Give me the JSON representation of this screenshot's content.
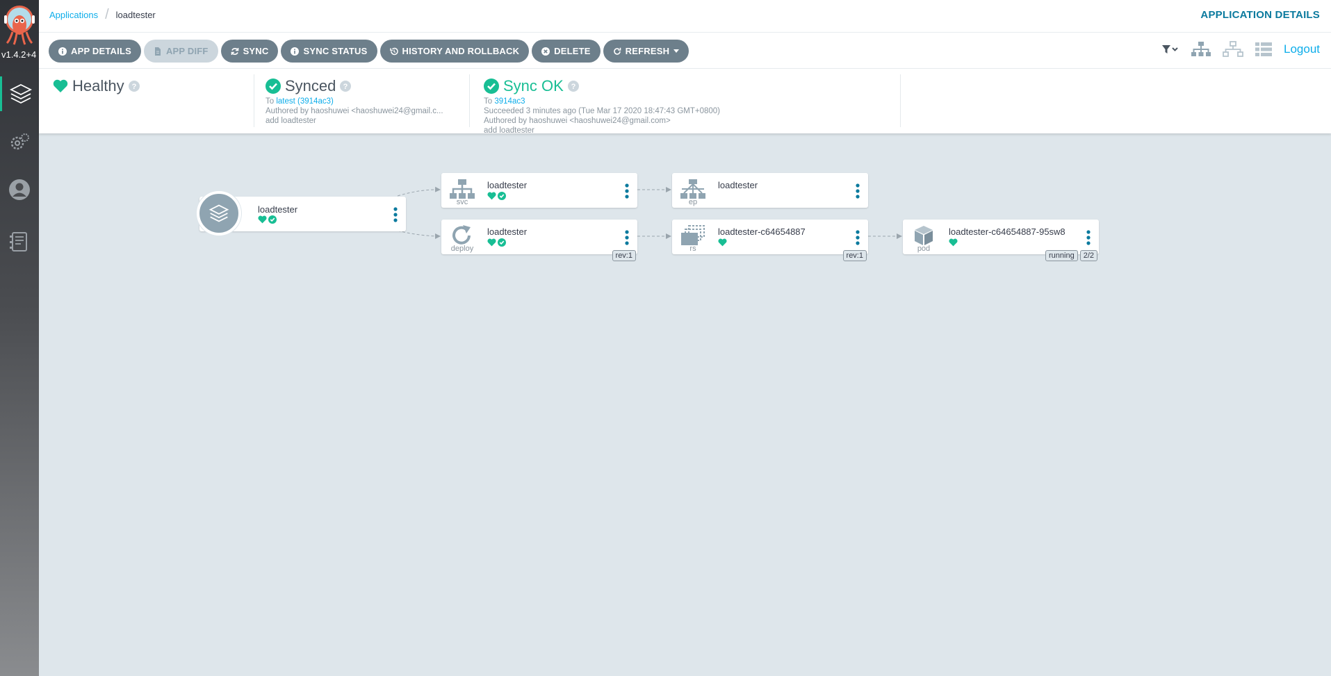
{
  "sidebar": {
    "version": "v1.4.2+4",
    "items": [
      {
        "name": "applications",
        "icon": "layers-icon"
      },
      {
        "name": "settings",
        "icon": "gear-icon"
      },
      {
        "name": "user-info",
        "icon": "user-icon"
      },
      {
        "name": "docs",
        "icon": "docs-icon"
      }
    ]
  },
  "header": {
    "breadcrumb": {
      "root": "Applications",
      "current": "loadtester"
    },
    "title": "APPLICATION DETAILS"
  },
  "toolbar": {
    "buttons": [
      {
        "label": "APP DETAILS",
        "icon": "info-icon"
      },
      {
        "label": "APP DIFF",
        "icon": "file-icon",
        "disabled": true
      },
      {
        "label": "SYNC",
        "icon": "sync-icon"
      },
      {
        "label": "SYNC STATUS",
        "icon": "info-icon"
      },
      {
        "label": "HISTORY AND ROLLBACK",
        "icon": "history-icon"
      },
      {
        "label": "DELETE",
        "icon": "close-circle-icon"
      },
      {
        "label": "REFRESH",
        "icon": "refresh-icon"
      }
    ],
    "logout": "Logout"
  },
  "status": {
    "health": {
      "label": "Healthy"
    },
    "sync": {
      "label": "Synced",
      "to_prefix": "To",
      "to_link": "latest (3914ac3)",
      "author": "Authored by haoshuwei <haoshuwei24@gmail.c...",
      "message": "add loadtester"
    },
    "operation": {
      "label": "Sync OK",
      "to_prefix": "To",
      "to_link": "3914ac3",
      "succeeded": "Succeeded 3 minutes ago (Tue Mar 17 2020 18:47:43 GMT+0800)",
      "author": "Authored by haoshuwei <haoshuwei24@gmail.com>",
      "message": "add loadtester"
    }
  },
  "graph": {
    "app": {
      "name": "loadtester"
    },
    "nodes": {
      "svc": {
        "name": "loadtester",
        "kind": "svc"
      },
      "ep": {
        "name": "loadtester",
        "kind": "ep"
      },
      "deploy": {
        "name": "loadtester",
        "kind": "deploy",
        "tag": "rev:1"
      },
      "rs": {
        "name": "loadtester-c64654887",
        "kind": "rs",
        "tag": "rev:1"
      },
      "pod": {
        "name": "loadtester-c64654887-95sw8",
        "kind": "pod",
        "tag1": "running",
        "tag2": "2/2"
      }
    }
  },
  "colors": {
    "healthy": "#18be94",
    "link": "#0dadea",
    "button": "#6d7f8b"
  }
}
